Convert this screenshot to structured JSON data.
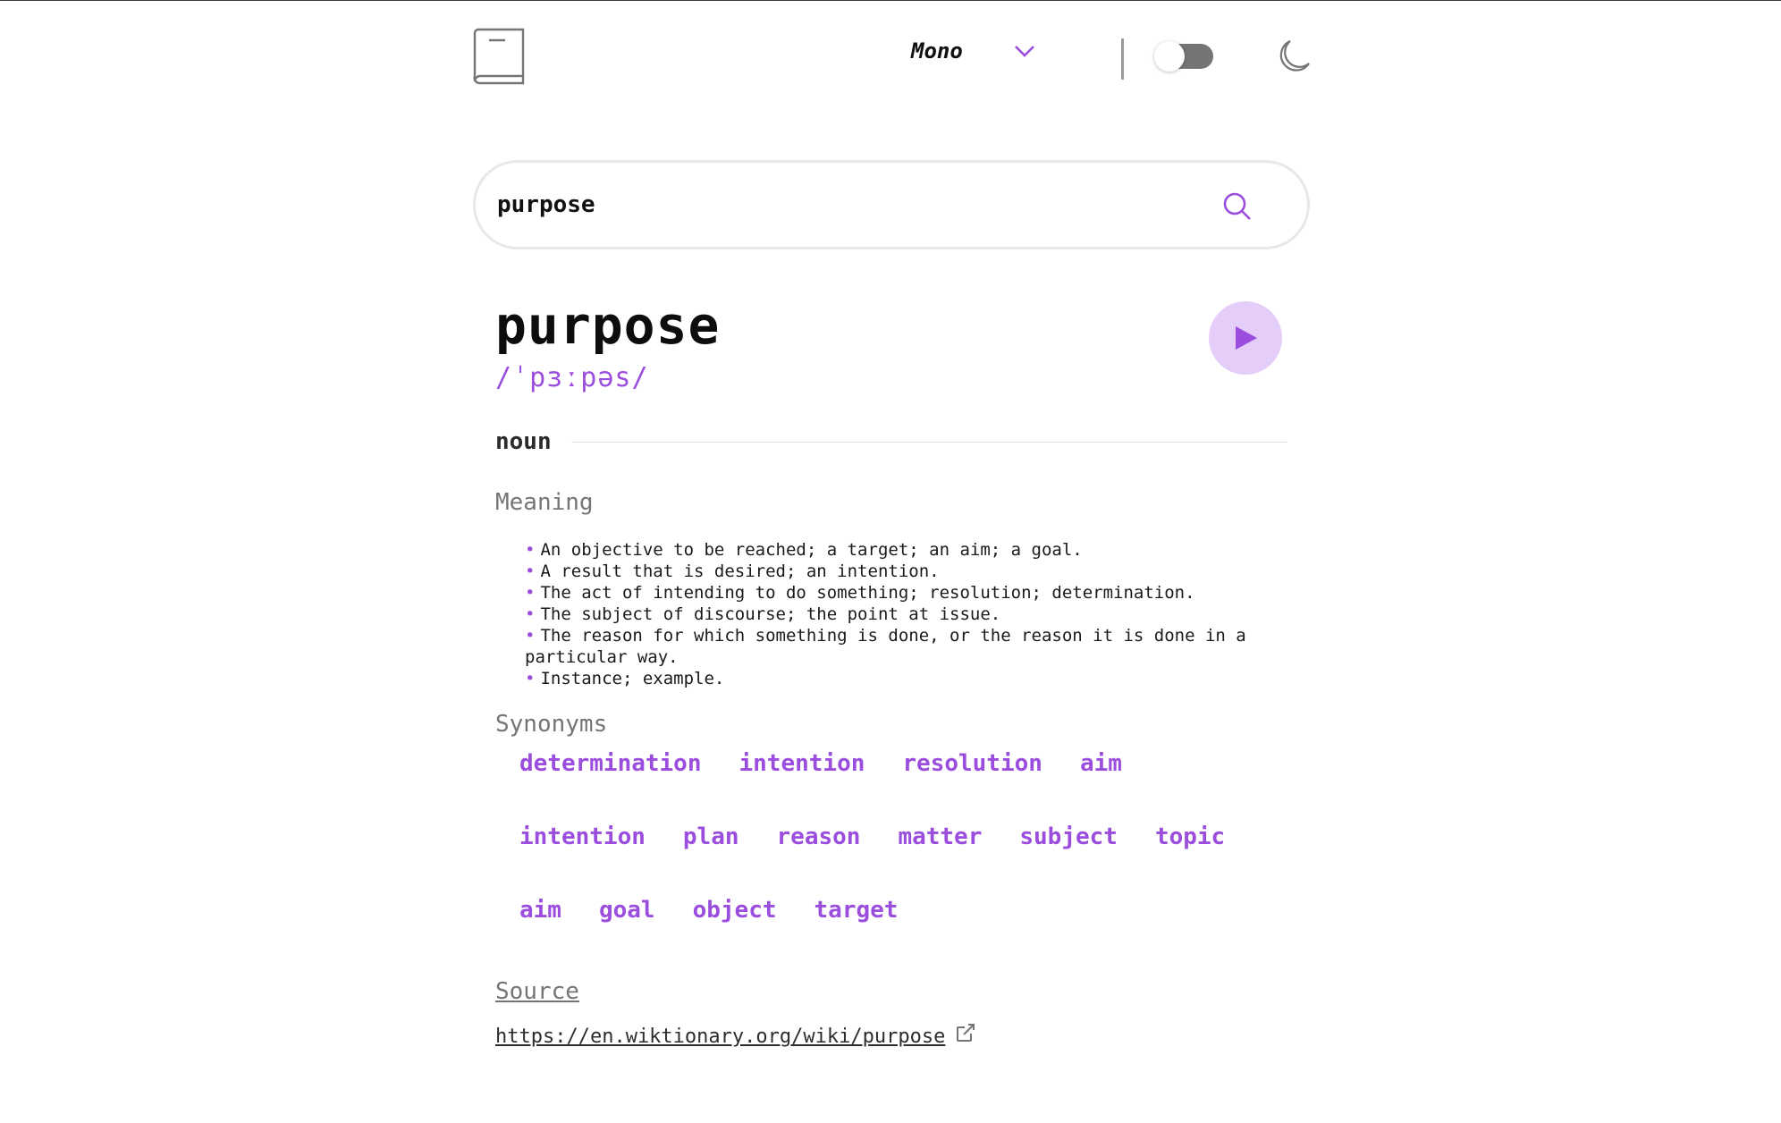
{
  "header": {
    "logo_icon": "book-icon",
    "font_selector": {
      "selected": "Mono",
      "icon": "chevron-down-icon"
    },
    "theme_toggle": {
      "state": "off"
    },
    "theme_icon": "moon-icon"
  },
  "search": {
    "value": "purpose",
    "icon": "search-icon"
  },
  "entry": {
    "word": "purpose",
    "phonetic": "/ˈpɜːpəs/",
    "play_icon": "play-icon",
    "part_of_speech": "noun",
    "meaning_heading": "Meaning",
    "meanings": [
      "An objective to be reached; a target; an aim; a goal.",
      "A result that is desired; an intention.",
      "The act of intending to do something; resolution; determination.",
      "The subject of discourse; the point at issue.",
      "The reason for which something is done, or the reason it is done in a particular way.",
      "Instance; example."
    ],
    "synonyms_heading": "Synonyms",
    "synonyms": [
      [
        "determination",
        "intention",
        "resolution",
        "aim"
      ],
      [
        "intention",
        "plan",
        "reason",
        "matter",
        "subject",
        "topic"
      ],
      [
        "aim",
        "goal",
        "object",
        "target"
      ]
    ]
  },
  "source": {
    "heading": "Source",
    "url": "https://en.wiktionary.org/wiki/purpose",
    "icon": "external-link-icon"
  },
  "colors": {
    "accent": "#9b4dde",
    "play_bg": "#e5cdfa",
    "muted": "#757575"
  }
}
